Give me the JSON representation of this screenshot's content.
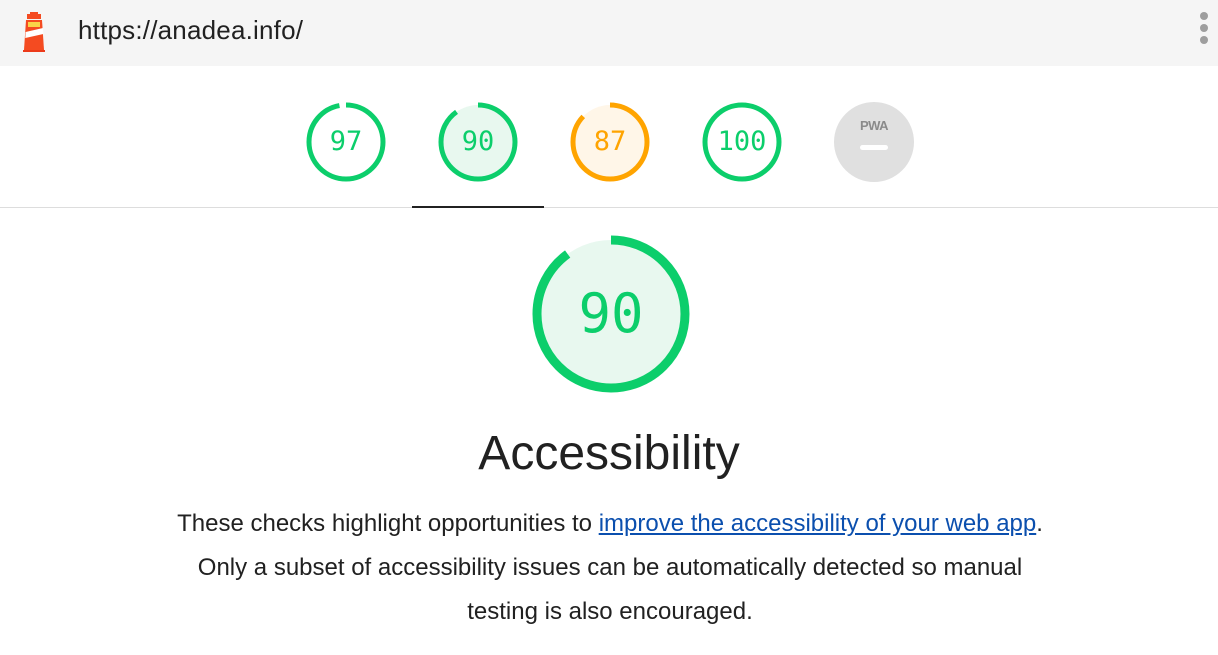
{
  "header": {
    "url": "https://anadea.info/",
    "logo_icon": "lighthouse-icon",
    "menu_icon": "kebab-menu-icon"
  },
  "gauges": [
    {
      "name": "gauge-performance",
      "score": "97",
      "fraction": 0.97,
      "color": "#0cce6b",
      "fill": "#ffffff"
    },
    {
      "name": "gauge-accessibility",
      "score": "90",
      "fraction": 0.9,
      "color": "#0cce6b",
      "fill": "#e8f8ef",
      "selected": true
    },
    {
      "name": "gauge-best-practices",
      "score": "87",
      "fraction": 0.87,
      "color": "#ffa400",
      "fill": "#fff6e8"
    },
    {
      "name": "gauge-seo",
      "score": "100",
      "fraction": 1.0,
      "color": "#0cce6b",
      "fill": "#ffffff"
    }
  ],
  "pwa": {
    "label": "PWA",
    "color": "#e0e0e0"
  },
  "category": {
    "score": "90",
    "fraction": 0.9,
    "color": "#0cce6b",
    "fill": "#e8f8ef",
    "title": "Accessibility",
    "desc_before": "These checks highlight opportunities to ",
    "desc_link": "improve the accessibility of your web app",
    "desc_after": ". Only a subset of accessibility issues can be automatically detected so manual testing is also encouraged."
  }
}
